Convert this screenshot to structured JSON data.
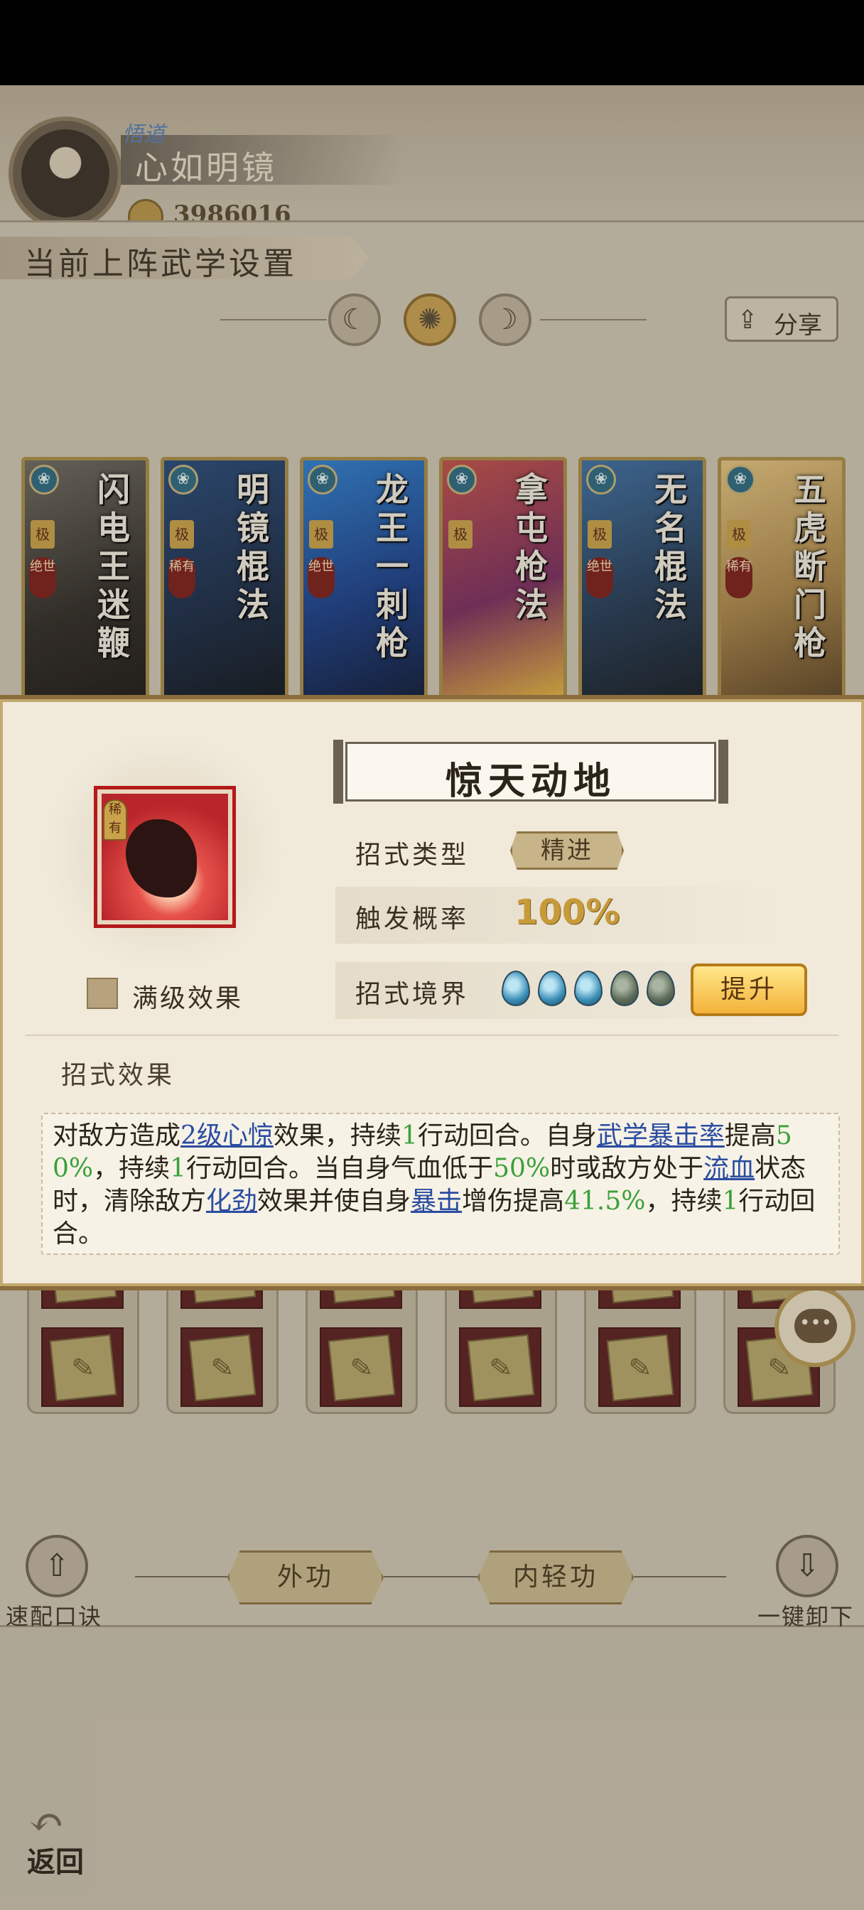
{
  "profile": {
    "enlighten_tag": "悟道",
    "name": "心如明镜",
    "coin_value": "3986016"
  },
  "panel": {
    "title": "当前上阵武学设置",
    "share_label": "分享",
    "mode_icons": [
      "moon-crescent-icon",
      "sun-icon",
      "moon-icon"
    ]
  },
  "skill_cards": [
    {
      "name": "闪电王迷鞭",
      "grade": "极",
      "tier": "绝世"
    },
    {
      "name": "明镜棍法",
      "grade": "极",
      "tier": "稀有"
    },
    {
      "name": "龙王一刺枪",
      "grade": "极",
      "tier": "绝世"
    },
    {
      "name": "拿屯枪法",
      "grade": "极",
      "tier": ""
    },
    {
      "name": "无名棍法",
      "grade": "极",
      "tier": "绝世"
    },
    {
      "name": "五虎断门枪",
      "grade": "极",
      "tier": "稀有"
    }
  ],
  "bottom": {
    "left_button_label": "速配口诀",
    "right_button_label": "一键卸下",
    "tabs": [
      "外功",
      "内轻功"
    ],
    "back_label": "返回"
  },
  "modal": {
    "skill_name": "惊天动地",
    "rarity": "稀有",
    "max_effect_label": "满级效果",
    "type_label": "招式类型",
    "type_value": "精进",
    "rate_label": "触发概率",
    "rate_value": "100%",
    "realm_label": "招式境界",
    "realm_level": 3,
    "realm_max": 5,
    "upgrade_label": "提升",
    "effect_heading": "招式效果",
    "effect_parts": [
      {
        "t": "对敌方造成",
        "s": "plain"
      },
      {
        "t": "2级心惊",
        "s": "link"
      },
      {
        "t": "效果，持续",
        "s": "plain"
      },
      {
        "t": "1",
        "s": "num"
      },
      {
        "t": "行动回合。自身",
        "s": "plain"
      },
      {
        "t": "武学暴击率",
        "s": "link"
      },
      {
        "t": "提高",
        "s": "plain"
      },
      {
        "t": "50%",
        "s": "num"
      },
      {
        "t": "，持续",
        "s": "plain"
      },
      {
        "t": "1",
        "s": "num"
      },
      {
        "t": "行动回合。当自身气血低于",
        "s": "plain"
      },
      {
        "t": "50%",
        "s": "num"
      },
      {
        "t": "时或敌方处于",
        "s": "plain"
      },
      {
        "t": "流血",
        "s": "link"
      },
      {
        "t": "状态时，清除敌方",
        "s": "plain"
      },
      {
        "t": "化劲",
        "s": "link"
      },
      {
        "t": "效果并使自身",
        "s": "plain"
      },
      {
        "t": "暴击",
        "s": "link"
      },
      {
        "t": "增伤提高",
        "s": "plain"
      },
      {
        "t": "41.5%",
        "s": "num"
      },
      {
        "t": "，持续",
        "s": "plain"
      },
      {
        "t": "1",
        "s": "num"
      },
      {
        "t": "行动回合。",
        "s": "plain"
      }
    ]
  },
  "colors": {
    "accent_gold": "#c79a3a",
    "link_blue": "#2b4da1",
    "number_green": "#3aa03a",
    "rarity_red": "#b5191a"
  }
}
